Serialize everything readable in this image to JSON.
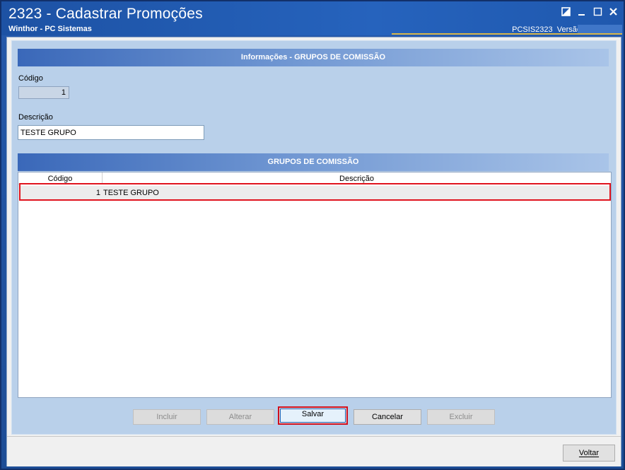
{
  "window": {
    "title": "2323 - Cadastrar Promoções",
    "subtitle": "Winthor - PC Sistemas",
    "routine": "PCSIS2323",
    "version_label": "Versão"
  },
  "info_section": {
    "header": "Informações - GRUPOS DE COMISSÃO",
    "codigo_label": "Código",
    "codigo_value": "1",
    "descricao_label": "Descrição",
    "descricao_value": "TESTE GRUPO"
  },
  "grupos_section": {
    "header": "GRUPOS DE COMISSÃO",
    "columns": [
      "Código",
      "Descrição"
    ],
    "rows": [
      {
        "codigo": "1",
        "descricao": "TESTE GRUPO"
      }
    ]
  },
  "actions": {
    "incluir": "Incluir",
    "alterar": "Alterar",
    "salvar": "Salvar",
    "cancelar": "Cancelar",
    "excluir": "Excluir",
    "voltar": "Voltar"
  }
}
